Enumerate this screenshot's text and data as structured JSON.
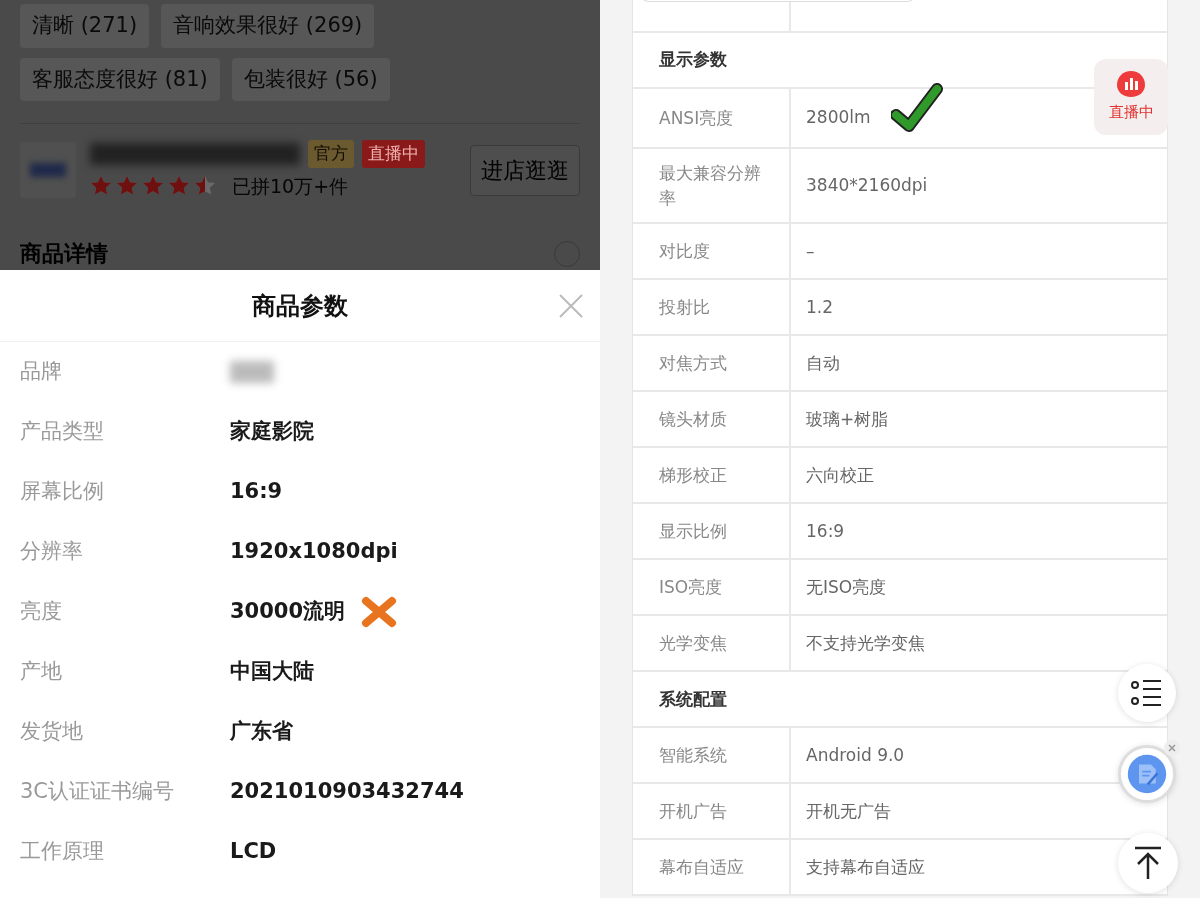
{
  "background_page": {
    "review_tags": [
      {
        "label": "清晰 (271)"
      },
      {
        "label": "音响效果很好 (269)"
      },
      {
        "label": "客服态度很好 (81)"
      },
      {
        "label": "包装很好 (56)"
      }
    ],
    "store": {
      "badges": [
        {
          "kind": "official",
          "label": "官方"
        },
        {
          "kind": "live",
          "label": "直播中"
        }
      ],
      "stars": 4.5,
      "sales": "已拼10万+件",
      "visit_button": "进店逛逛"
    },
    "section_title": "商品详情"
  },
  "params_sheet": {
    "title": "商品参数",
    "rows": [
      {
        "label": "品牌",
        "kind": "blurred"
      },
      {
        "label": "产品类型",
        "kind": "text",
        "value": "家庭影院"
      },
      {
        "label": "屏幕比例",
        "kind": "text",
        "value": "16:9"
      },
      {
        "label": "分辨率",
        "kind": "text",
        "value": "1920x1080dpi"
      },
      {
        "label": "亮度",
        "kind": "text",
        "value": "30000流明",
        "marked_wrong": true
      },
      {
        "label": "产地",
        "kind": "text",
        "value": "中国大陆"
      },
      {
        "label": "发货地",
        "kind": "text",
        "value": "广东省"
      },
      {
        "label": "3C认证证书编号",
        "kind": "text",
        "value": "2021010903432744"
      },
      {
        "label": "工作原理",
        "kind": "text",
        "value": "LCD"
      }
    ]
  },
  "spec_table": {
    "groups": [
      {
        "title": "显示参数",
        "rows": [
          {
            "label": "ANSI亮度",
            "value": "2800lm",
            "marked_right": true
          },
          {
            "label": "最大兼容分辨率",
            "value": "3840*2160dpi"
          },
          {
            "label": "对比度",
            "value": "–"
          },
          {
            "label": "投射比",
            "value": "1.2"
          },
          {
            "label": "对焦方式",
            "value": "自动"
          },
          {
            "label": "镜头材质",
            "value": "玻璃+树脂"
          },
          {
            "label": "梯形校正",
            "value": "六向校正"
          },
          {
            "label": "显示比例",
            "value": "16:9"
          },
          {
            "label": "ISO亮度",
            "value": "无ISO亮度"
          },
          {
            "label": "光学变焦",
            "value": "不支持光学变焦"
          }
        ]
      },
      {
        "title": "系统配置",
        "rows": [
          {
            "label": "智能系统",
            "value": "Android 9.0"
          },
          {
            "label": "开机广告",
            "value": "开机无广告"
          },
          {
            "label": "幕布自适应",
            "value": "支持幕布自适应"
          }
        ]
      }
    ]
  },
  "live_button": {
    "label": "直播中"
  }
}
